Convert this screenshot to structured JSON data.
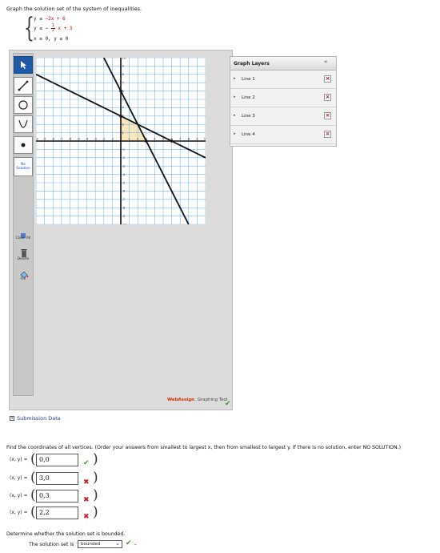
{
  "question": "Graph the solution set of the system of inequalities.",
  "system": {
    "line1_left": "y ≤",
    "line1_right": "−2x + 6",
    "line2_left": "y ≤ −",
    "line2_frac_num": "1",
    "line2_frac_den": "2",
    "line2_right": "x + 3",
    "line3": "x ≥  0,  y ≥  0"
  },
  "toolbar": {
    "no_solution": "No Solution",
    "clear_all": "Clear All",
    "delete": "Delete",
    "fill": "Fill"
  },
  "graph": {
    "x_min": -10,
    "x_max": 10,
    "y_min": -10,
    "y_max": 10,
    "x_tick_labels": [
      "-10",
      "-9",
      "-8",
      "-7",
      "-6",
      "-5",
      "-4",
      "-3",
      "-2",
      "-1",
      "1",
      "2",
      "3",
      "4",
      "5",
      "6",
      "7",
      "8",
      "9",
      "10"
    ],
    "y_tick_labels": [
      "10",
      "9",
      "8",
      "7",
      "6",
      "5",
      "4",
      "3",
      "2",
      "1",
      "-1",
      "-2",
      "-3",
      "-4",
      "-5",
      "-6",
      "-7",
      "-8",
      "-9",
      "-10"
    ],
    "lines": [
      {
        "name": "Line 1",
        "slope": -2,
        "intercept": 6
      },
      {
        "name": "Line 2",
        "slope": -0.5,
        "intercept": 3
      }
    ],
    "shaded_vertices": [
      [
        0,
        0
      ],
      [
        3,
        0
      ],
      [
        2,
        2
      ],
      [
        0,
        3
      ]
    ],
    "colors": {
      "line": "#111111",
      "grid": "#7ab8ee",
      "fill": "#f6e4b4"
    }
  },
  "layers": {
    "title": "Graph Layers",
    "collapse": "«",
    "items": [
      "Line 1",
      "Line 2",
      "Line 3",
      "Line 4"
    ]
  },
  "brand": {
    "name": "WebAssign",
    "suffix": ". Graphing Tool"
  },
  "submission": {
    "label": "Submission Data",
    "box": "+"
  },
  "vertex_question": "Find the coordinates of all vertices. (Order your answers from smallest to largest x, then from smallest to largest y. If there is no solution, enter NO SOLUTION.)",
  "answers": [
    {
      "label": "(x, y) =",
      "value": "0,0",
      "status": "correct"
    },
    {
      "label": "(x, y) =",
      "value": "3,0",
      "status": "incorrect"
    },
    {
      "label": "(x, y) =",
      "value": "0,3",
      "status": "incorrect"
    },
    {
      "label": "(x, y) =",
      "value": "2,2",
      "status": "incorrect"
    }
  ],
  "marks": {
    "ok": "✔",
    "bad": "✖"
  },
  "bounded": {
    "question": "Determine whether the solution set is bounded.",
    "label": "The solution set is",
    "selected": "bounded",
    "suffix": "."
  }
}
